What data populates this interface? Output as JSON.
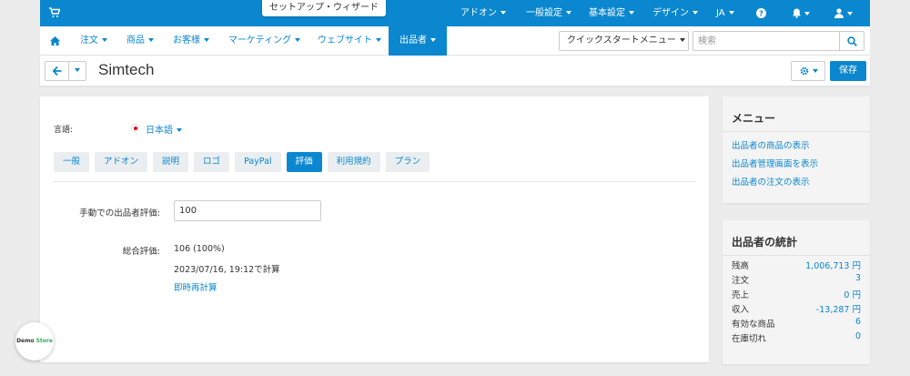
{
  "topbar": {
    "wizard_label": "セットアップ・ウィザード",
    "menus": [
      "アドオン",
      "一般設定",
      "基本設定",
      "デザイン",
      "JA"
    ],
    "icons": [
      "cart-icon",
      "help-icon",
      "bell-icon",
      "user-icon"
    ]
  },
  "nav": {
    "items": [
      "注文",
      "商品",
      "お客様",
      "マーケティング",
      "ウェブサイト",
      "出品者"
    ],
    "active": "出品者",
    "quickstart_label": "クイックスタートメニュー",
    "search_placeholder": "検索"
  },
  "header": {
    "title": "Simtech",
    "save_label": "保存"
  },
  "main": {
    "language_label": "言語:",
    "language_value": "日本語",
    "tabs": [
      "一般",
      "アドオン",
      "説明",
      "ロゴ",
      "PayPal",
      "評価",
      "利用規約",
      "プラン"
    ],
    "active_tab": "評価",
    "manual_rating_label": "手動での出品者評価:",
    "manual_rating_value": "100",
    "overall_rating_label": "総合評価:",
    "overall_rating_value": "106 (100%)",
    "calculated_at": "2023/07/16, 19:12で計算",
    "recalculate_link": "即時再計算"
  },
  "sidebar_menu": {
    "title": "メニュー",
    "links": [
      "出品者の商品の表示",
      "出品者管理画面を表示",
      "出品者の注文の表示"
    ]
  },
  "sidebar_stats": {
    "title": "出品者の統計",
    "rows": [
      {
        "label": "残高",
        "value": "1,006,713 円"
      },
      {
        "label": "注文",
        "value": "3"
      },
      {
        "label": "売上",
        "value": "0 円"
      },
      {
        "label": "収入",
        "value": "-13,287 円"
      },
      {
        "label": "有効な商品",
        "value": "6"
      },
      {
        "label": "在庫切れ",
        "value": "0"
      }
    ]
  },
  "demo_badge": {
    "part1": "Demo",
    "part2": "Store"
  },
  "colors": {
    "accent": "#0b87cf",
    "background": "#ececec",
    "panel": "#ffffff",
    "sidebar": "#f4f4f4"
  }
}
